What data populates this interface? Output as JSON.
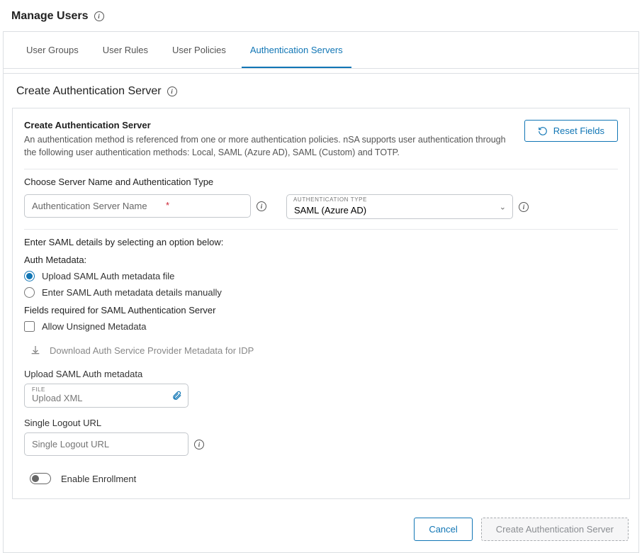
{
  "header": {
    "title": "Manage Users"
  },
  "tabs": [
    {
      "label": "User Groups"
    },
    {
      "label": "User Rules"
    },
    {
      "label": "User Policies"
    },
    {
      "label": "Authentication Servers"
    }
  ],
  "subheader": {
    "title": "Create Authentication Server"
  },
  "intro": {
    "heading": "Create Authentication Server",
    "desc": "An authentication method is referenced from one or more authentication policies. nSA supports user authentication through the following user authentication methods: Local, SAML (Azure AD), SAML (Custom) and TOTP."
  },
  "reset_btn": "Reset Fields",
  "choose_label": "Choose Server Name and Authentication Type",
  "server_name_placeholder": "Authentication Server Name",
  "auth_type_label": "AUTHENTICATION TYPE",
  "auth_type_value": "SAML (Azure AD)",
  "saml_instr": "Enter SAML details by selecting an option below:",
  "auth_meta_label": "Auth Metadata:",
  "radio_upload": "Upload SAML Auth metadata file",
  "radio_manual": "Enter SAML Auth metadata details manually",
  "fields_req": "Fields required for SAML Authentication Server",
  "allow_unsigned": "Allow Unsigned Metadata",
  "download_link": "Download Auth Service Provider Metadata for IDP",
  "upload_label": "Upload SAML Auth metadata",
  "file_mini": "FILE",
  "file_placeholder": "Upload XML",
  "logout_label": "Single Logout URL",
  "logout_placeholder": "Single Logout URL",
  "enable_enrollment": "Enable Enrollment",
  "buttons": {
    "cancel": "Cancel",
    "create": "Create Authentication Server"
  }
}
